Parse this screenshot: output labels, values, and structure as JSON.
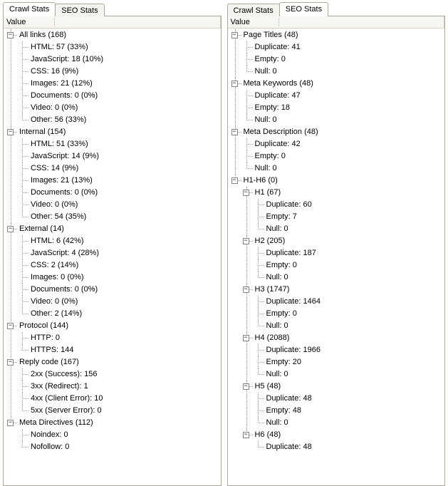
{
  "left": {
    "tabs": [
      {
        "label": "Crawl Stats",
        "active": true
      },
      {
        "label": "SEO Stats",
        "active": false
      }
    ],
    "header": "Value",
    "tree": [
      {
        "label": "All links (168)",
        "expanded": true,
        "children": [
          {
            "label": "HTML: 57 (33%)"
          },
          {
            "label": "JavaScript: 18 (10%)"
          },
          {
            "label": "CSS: 16 (9%)"
          },
          {
            "label": "Images: 21 (12%)"
          },
          {
            "label": "Documents: 0 (0%)"
          },
          {
            "label": "Video: 0 (0%)"
          },
          {
            "label": "Other: 56 (33%)"
          }
        ]
      },
      {
        "label": "Internal (154)",
        "expanded": true,
        "children": [
          {
            "label": "HTML: 51 (33%)"
          },
          {
            "label": "JavaScript: 14 (9%)"
          },
          {
            "label": "CSS: 14 (9%)"
          },
          {
            "label": "Images: 21 (13%)"
          },
          {
            "label": "Documents: 0 (0%)"
          },
          {
            "label": "Video: 0 (0%)"
          },
          {
            "label": "Other: 54 (35%)"
          }
        ]
      },
      {
        "label": "External (14)",
        "expanded": true,
        "children": [
          {
            "label": "HTML: 6 (42%)"
          },
          {
            "label": "JavaScript: 4 (28%)"
          },
          {
            "label": "CSS: 2 (14%)"
          },
          {
            "label": "Images: 0 (0%)"
          },
          {
            "label": "Documents: 0 (0%)"
          },
          {
            "label": "Video: 0 (0%)"
          },
          {
            "label": "Other: 2 (14%)"
          }
        ]
      },
      {
        "label": "Protocol (144)",
        "expanded": true,
        "children": [
          {
            "label": "HTTP: 0"
          },
          {
            "label": "HTTPS: 144"
          }
        ]
      },
      {
        "label": "Reply code (167)",
        "expanded": true,
        "children": [
          {
            "label": "2xx (Success): 156"
          },
          {
            "label": "3xx (Redirect): 1"
          },
          {
            "label": "4xx (Client Error): 10"
          },
          {
            "label": "5xx (Server Error): 0"
          }
        ]
      },
      {
        "label": "Meta Directives (112)",
        "expanded": true,
        "children": [
          {
            "label": "Noindex: 0"
          },
          {
            "label": "Nofollow: 0"
          }
        ]
      }
    ]
  },
  "right": {
    "tabs": [
      {
        "label": "Crawl Stats",
        "active": false
      },
      {
        "label": "SEO Stats",
        "active": true
      }
    ],
    "header": "Value",
    "tree": [
      {
        "label": "Page Titles (48)",
        "expanded": true,
        "children": [
          {
            "label": "Duplicate: 41"
          },
          {
            "label": "Empty: 0"
          },
          {
            "label": "Null: 0"
          }
        ]
      },
      {
        "label": "Meta Keywords (48)",
        "expanded": true,
        "children": [
          {
            "label": "Duplicate: 47"
          },
          {
            "label": "Empty: 18"
          },
          {
            "label": "Null: 0"
          }
        ]
      },
      {
        "label": "Meta Description (48)",
        "expanded": true,
        "children": [
          {
            "label": "Duplicate: 42"
          },
          {
            "label": "Empty: 0"
          },
          {
            "label": "Null: 0"
          }
        ]
      },
      {
        "label": "H1-H6 (0)",
        "expanded": true,
        "children": [
          {
            "label": "H1 (67)",
            "expanded": true,
            "children": [
              {
                "label": "Duplicate: 60"
              },
              {
                "label": "Empty: 7"
              },
              {
                "label": "Null: 0"
              }
            ]
          },
          {
            "label": "H2 (205)",
            "expanded": true,
            "children": [
              {
                "label": "Duplicate: 187"
              },
              {
                "label": "Empty: 0"
              },
              {
                "label": "Null: 0"
              }
            ]
          },
          {
            "label": "H3 (1747)",
            "expanded": true,
            "children": [
              {
                "label": "Duplicate: 1464"
              },
              {
                "label": "Empty: 0"
              },
              {
                "label": "Null: 0"
              }
            ]
          },
          {
            "label": "H4 (2088)",
            "expanded": true,
            "children": [
              {
                "label": "Duplicate: 1966"
              },
              {
                "label": "Empty: 20"
              },
              {
                "label": "Null: 0"
              }
            ]
          },
          {
            "label": "H5 (48)",
            "expanded": true,
            "children": [
              {
                "label": "Duplicate: 48"
              },
              {
                "label": "Empty: 48"
              },
              {
                "label": "Null: 0"
              }
            ]
          },
          {
            "label": "H6 (48)",
            "expanded": true,
            "children": [
              {
                "label": "Duplicate: 48"
              }
            ]
          }
        ]
      }
    ]
  }
}
